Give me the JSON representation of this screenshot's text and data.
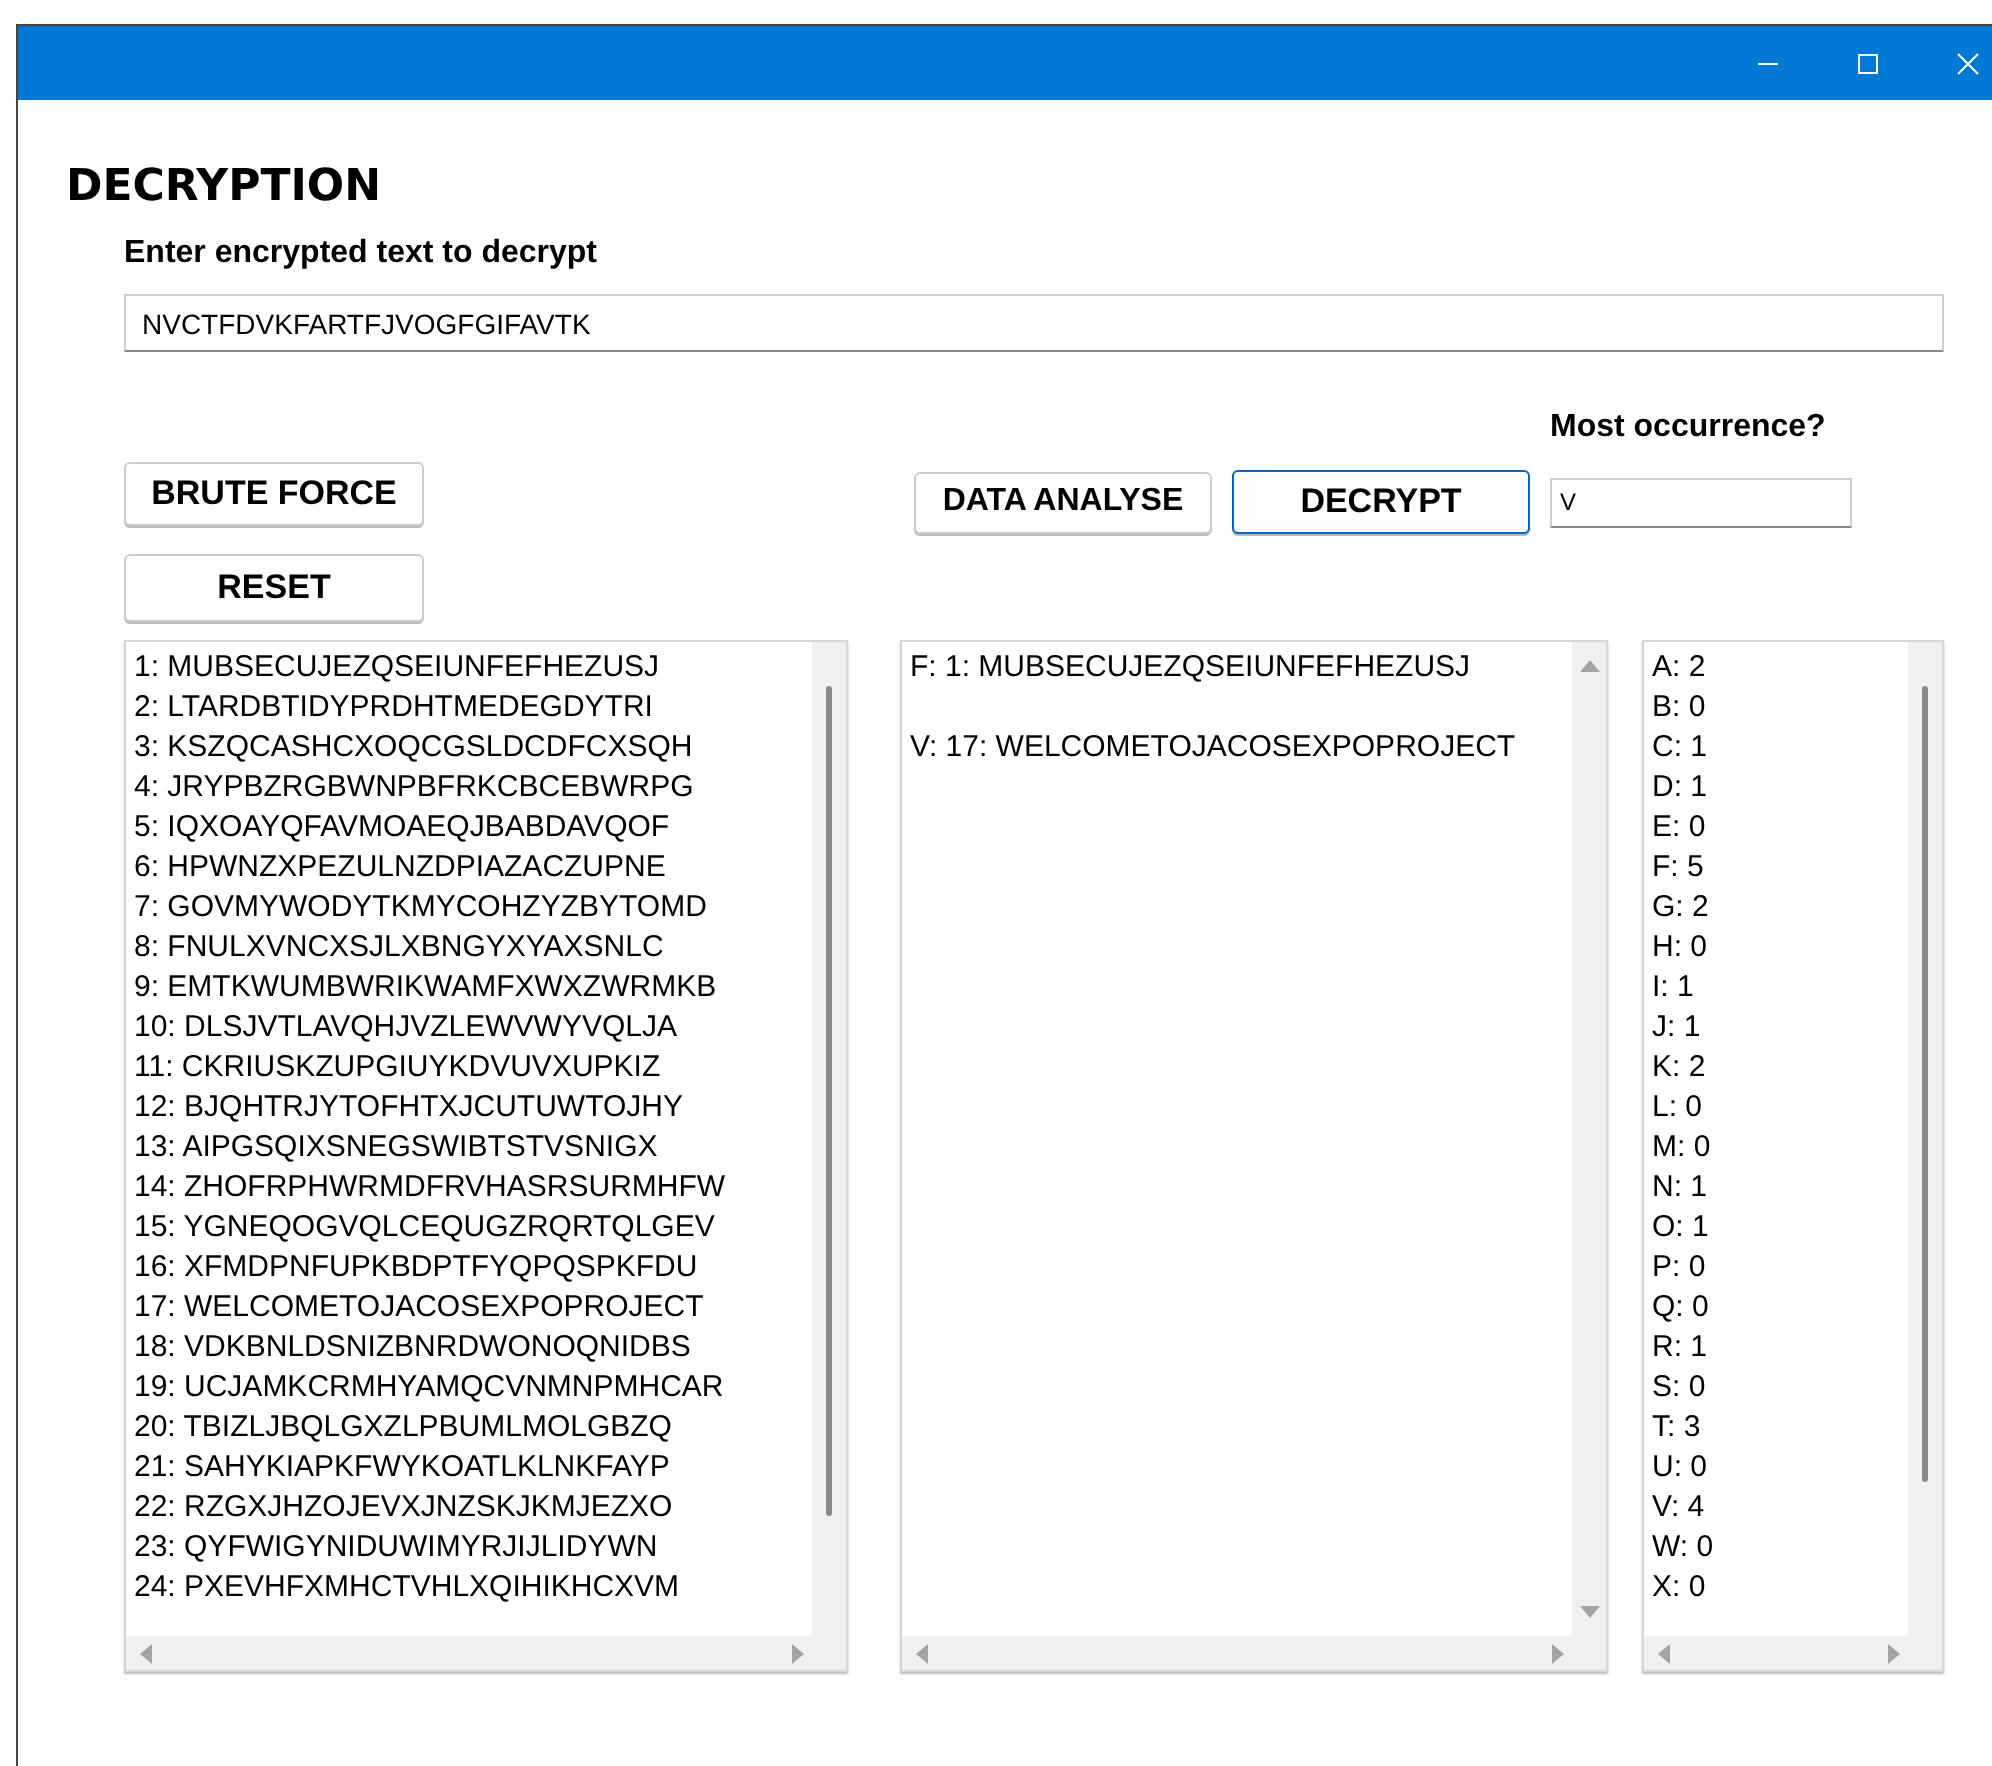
{
  "heading": "DECRYPTION",
  "encrypted_input": {
    "label": "Enter encrypted text to decrypt",
    "value": "NVCTFDVKFARTFJVOGFGIFAVTK"
  },
  "brute_force_button": {
    "label": "BRUTE FORCE",
    "focused": false
  },
  "reset_button": {
    "label": "RESET",
    "focused": false
  },
  "data_analyse_button": {
    "label": "DATA ANALYSE",
    "focused": false
  },
  "decrypt_button": {
    "label": "DECRYPT",
    "focused": true
  },
  "most_occurrence": {
    "label": "Most occurrence?",
    "value": "V"
  },
  "brute_force_results": [
    "1: MUBSECUJEZQSEIUNFEFHEZUSJ",
    "2: LTARDBTIDYPRDHTMEDEGDYTRI",
    "3: KSZQCASHCXOQCGSLDCDFCXSQH",
    "4: JRYPBZRGBWNPBFRKCBCEBWRPG",
    "5: IQXOAYQFAVMOAEQJBABDAVQOF",
    "6: HPWNZXPEZULNZDPIAZACZUPNE",
    "7: GOVMYWODYTKMYCOHZYZBYTOMD",
    "8: FNULXVNCXSJLXBNGYXYAXSNLC",
    "9: EMTKWUMBWRIKWAMFXWXZWRMKB",
    "10: DLSJVTLAVQHJVZLEWVWYVQLJA",
    "11: CKRIUSKZUPGIUYKDVUVXUPKIZ",
    "12: BJQHTRJYTOFHTXJCUTUWTOJHY",
    "13: AIPGSQIXSNEGSWIBTSTVSNIGX",
    "14: ZHOFRPHWRMDFRVHASRSURMHFW",
    "15: YGNEQOGVQLCEQUGZRQRTQLGEV",
    "16: XFMDPNFUPKBDPTFYQPQSPKFDU",
    "17: WELCOMETOJACOSEXPOPROJECT",
    "18: VDKBNLDSNIZBNRDWONOQNIDBS",
    "19: UCJAMKCRMHYAMQCVNMNPMHCAR",
    "20: TBIZLJBQLGXZLPBUMLMOLGBZQ",
    "21: SAHYKIAPKFWYKOATLKLNKFAYP",
    "22: RZGXJHZOJEVXJNZSKJKMJEZXO",
    "23: QYFWIGYNIDUWIMYRJIJLIDYWN",
    "24: PXEVHFXMHCTVHLXQIHIKHCXVM"
  ],
  "decrypted_results": [
    "F: 1: MUBSECUJEZQSEIUNFEFHEZUSJ",
    "V: 17: WELCOMETOJACOSEXPOPROJECT"
  ],
  "letter_counts": [
    "A: 2",
    "B: 0",
    "C: 1",
    "D: 1",
    "E: 0",
    "F: 5",
    "G: 2",
    "H: 0",
    "I: 1",
    "J: 1",
    "K: 2",
    "L: 0",
    "M: 0",
    "N: 1",
    "O: 1",
    "P: 0",
    "Q: 0",
    "R: 1",
    "S: 0",
    "T: 3",
    "U: 0",
    "V: 4",
    "W: 0",
    "X: 0"
  ]
}
